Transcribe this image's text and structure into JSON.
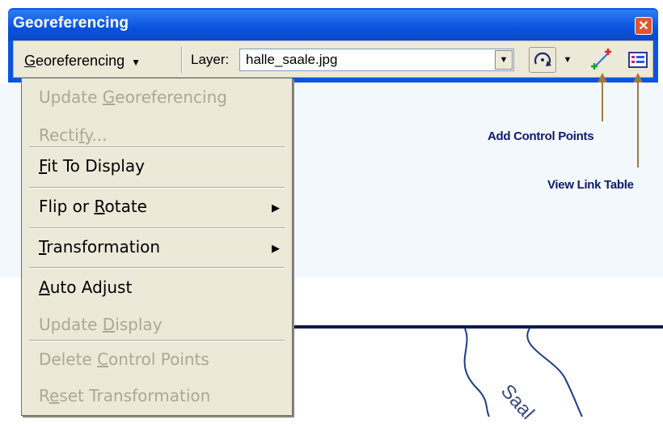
{
  "window": {
    "title": "Georeferencing"
  },
  "toolbar": {
    "menu_label": "Georeferencing",
    "layer_label": "Layer:",
    "layer_value": "halle_saale.jpg"
  },
  "menu": {
    "items": [
      {
        "pre": "Update ",
        "ul": "G",
        "post": "eoreferencing",
        "enabled": false
      },
      {
        "pre": "Recti",
        "ul": "f",
        "post": "y...",
        "enabled": false
      },
      {
        "pre": "",
        "ul": "F",
        "post": "it To Display",
        "enabled": true
      },
      {
        "pre": "Flip or ",
        "ul": "R",
        "post": "otate",
        "enabled": true,
        "submenu": true
      },
      {
        "pre": "",
        "ul": "T",
        "post": "ransformation",
        "enabled": true,
        "submenu": true
      },
      {
        "pre": "",
        "ul": "A",
        "post": "uto Adjust",
        "enabled": true
      },
      {
        "pre": "Update ",
        "ul": "D",
        "post": "isplay",
        "enabled": false
      },
      {
        "pre": "Delete ",
        "ul": "C",
        "post": "ontrol Points",
        "enabled": false
      },
      {
        "pre": "R",
        "ul": "e",
        "post": "set Transformation",
        "enabled": false
      }
    ]
  },
  "callouts": {
    "add_control_points": "Add Control Points",
    "view_link_table": "View Link Table"
  },
  "map": {
    "label": "Saal"
  },
  "colors": {
    "title_bar": "#0a52dc",
    "callout_text": "#0d1a6e",
    "arrow": "#a8763a",
    "menu_bg": "#ece9d8",
    "disabled_text": "#aca899"
  }
}
